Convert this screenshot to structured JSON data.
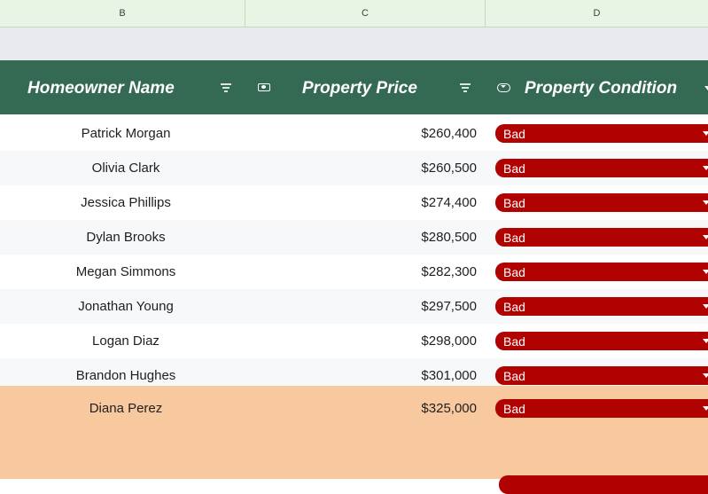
{
  "column_letters": [
    "B",
    "C",
    "D"
  ],
  "table": {
    "headers": [
      "Homeowner Name",
      "Property Price",
      "Property Condition"
    ],
    "header_bg": "#346a53",
    "rows": [
      {
        "name": "Patrick Morgan",
        "price": "$260,400",
        "condition": "Bad"
      },
      {
        "name": "Olivia Clark",
        "price": "$260,500",
        "condition": "Bad"
      },
      {
        "name": "Jessica Phillips",
        "price": "$274,400",
        "condition": "Bad"
      },
      {
        "name": "Dylan Brooks",
        "price": "$280,500",
        "condition": "Bad"
      },
      {
        "name": "Megan Simmons",
        "price": "$282,300",
        "condition": "Bad"
      },
      {
        "name": "Jonathan Young",
        "price": "$297,500",
        "condition": "Bad"
      },
      {
        "name": "Logan Diaz",
        "price": "$298,000",
        "condition": "Bad"
      },
      {
        "name": "Brandon Hughes",
        "price": "$301,000",
        "condition": "Bad"
      },
      {
        "name": "Diana Perez",
        "price": "$325,000",
        "condition": "Bad"
      }
    ]
  },
  "colors": {
    "row_white": "#ffffff",
    "row_stripe": "#f6f8f9",
    "highlight_row": "#f8c89e",
    "chip_bad": "#b10202"
  },
  "icons": [
    "filter-icon",
    "money-icon",
    "dropdown-type-icon",
    "chevron-down-icon"
  ]
}
